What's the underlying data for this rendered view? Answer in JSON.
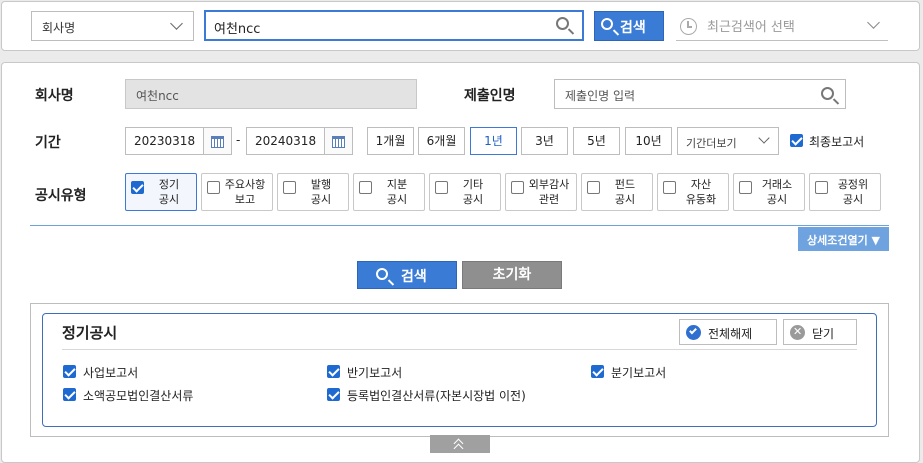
{
  "top": {
    "company_select": "회사명",
    "search_value": "여천ncc",
    "search_button": "검색",
    "recent_placeholder": "최근검색어 선택"
  },
  "form": {
    "company_label": "회사명",
    "company_value": "여천ncc",
    "submitter_label": "제출인명",
    "submitter_placeholder": "제출인명 입력",
    "period_label": "기간",
    "date_from": "20230318",
    "date_sep": "-",
    "date_to": "20240318",
    "period_buttons": [
      {
        "label": "1개월",
        "selected": false
      },
      {
        "label": "6개월",
        "selected": false
      },
      {
        "label": "1년",
        "selected": true
      },
      {
        "label": "3년",
        "selected": false
      },
      {
        "label": "5년",
        "selected": false
      },
      {
        "label": "10년",
        "selected": false
      }
    ],
    "period_more": "기간더보기",
    "final_report_label": "최종보고서",
    "final_report_checked": true,
    "type_label": "공시유형",
    "types": [
      {
        "line1": "정기",
        "line2": "공시",
        "checked": true
      },
      {
        "line1": "주요사항",
        "line2": "보고",
        "checked": false
      },
      {
        "line1": "발행",
        "line2": "공시",
        "checked": false
      },
      {
        "line1": "지분",
        "line2": "공시",
        "checked": false
      },
      {
        "line1": "기타",
        "line2": "공시",
        "checked": false
      },
      {
        "line1": "외부감사",
        "line2": "관련",
        "checked": false
      },
      {
        "line1": "펀드",
        "line2": "공시",
        "checked": false
      },
      {
        "line1": "자산",
        "line2": "유동화",
        "checked": false
      },
      {
        "line1": "거래소",
        "line2": "공시",
        "checked": false
      },
      {
        "line1": "공정위",
        "line2": "공시",
        "checked": false
      }
    ],
    "advanced_button": "상세조건열기 ▼",
    "search_button": "검색",
    "reset_button": "초기화"
  },
  "subtypes": {
    "title": "정기공시",
    "deselect_all": "전체해제",
    "close": "닫기",
    "items": [
      {
        "label": "사업보고서",
        "checked": true
      },
      {
        "label": "반기보고서",
        "checked": true
      },
      {
        "label": "분기보고서",
        "checked": true
      },
      {
        "label": "소액공모법인결산서류",
        "checked": true
      },
      {
        "label": "등록법인결산서류(자본시장법 이전)",
        "checked": true
      }
    ]
  },
  "colors": {
    "accent": "#3a7bd5",
    "reset": "#8f8f8f",
    "advanced": "#6fa3e0"
  }
}
